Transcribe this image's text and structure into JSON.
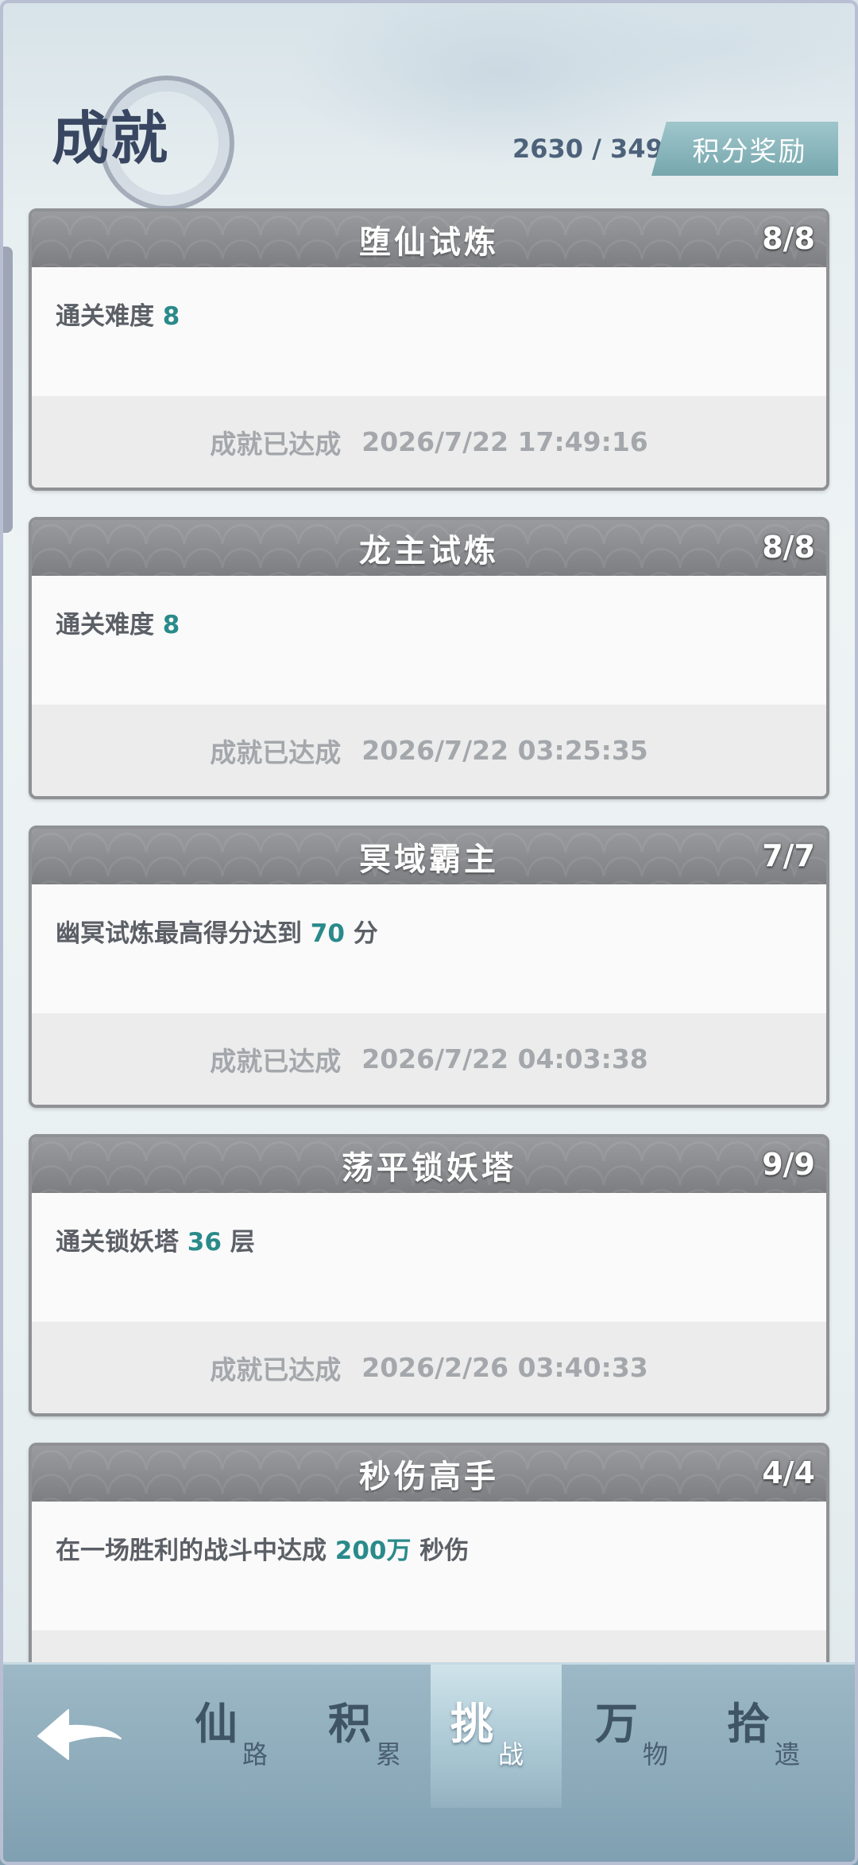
{
  "header": {
    "title": "成就",
    "score_current": "2630",
    "score_separator": " / ",
    "score_total": "3490",
    "reward_button": "积分奖励"
  },
  "achievements": [
    {
      "title": "堕仙试炼",
      "count": "8/8",
      "desc_pre": "通关难度 ",
      "desc_hl": "8",
      "desc_post": "",
      "status": "成就已达成",
      "time": "2026/7/22 17:49:16"
    },
    {
      "title": "龙主试炼",
      "count": "8/8",
      "desc_pre": "通关难度 ",
      "desc_hl": "8",
      "desc_post": "",
      "status": "成就已达成",
      "time": "2026/7/22 03:25:35"
    },
    {
      "title": "冥域霸主",
      "count": "7/7",
      "desc_pre": "幽冥试炼最高得分达到 ",
      "desc_hl": "70",
      "desc_post": " 分",
      "status": "成就已达成",
      "time": "2026/7/22 04:03:38"
    },
    {
      "title": "荡平锁妖塔",
      "count": "9/9",
      "desc_pre": "通关锁妖塔 ",
      "desc_hl": "36",
      "desc_post": " 层",
      "status": "成就已达成",
      "time": "2026/2/26 03:40:33"
    },
    {
      "title": "秒伤高手",
      "count": "4/4",
      "desc_pre": "在一场胜利的战斗中达成 ",
      "desc_hl": "200万",
      "desc_post": " 秒伤",
      "status": "",
      "time": ""
    }
  ],
  "nav": {
    "back_icon": "back-arrow-icon",
    "tabs": [
      {
        "big": "仙",
        "small": "路"
      },
      {
        "big": "积",
        "small": "累"
      },
      {
        "big": "挑",
        "small": "战"
      },
      {
        "big": "万",
        "small": "物"
      },
      {
        "big": "拾",
        "small": "遗"
      }
    ],
    "active_index": 2
  },
  "colors": {
    "highlight": "#2a8a8a",
    "card_header": "#8a8b8f",
    "reward_button": "#86b3b9",
    "nav_bg": "#8fadbd"
  }
}
